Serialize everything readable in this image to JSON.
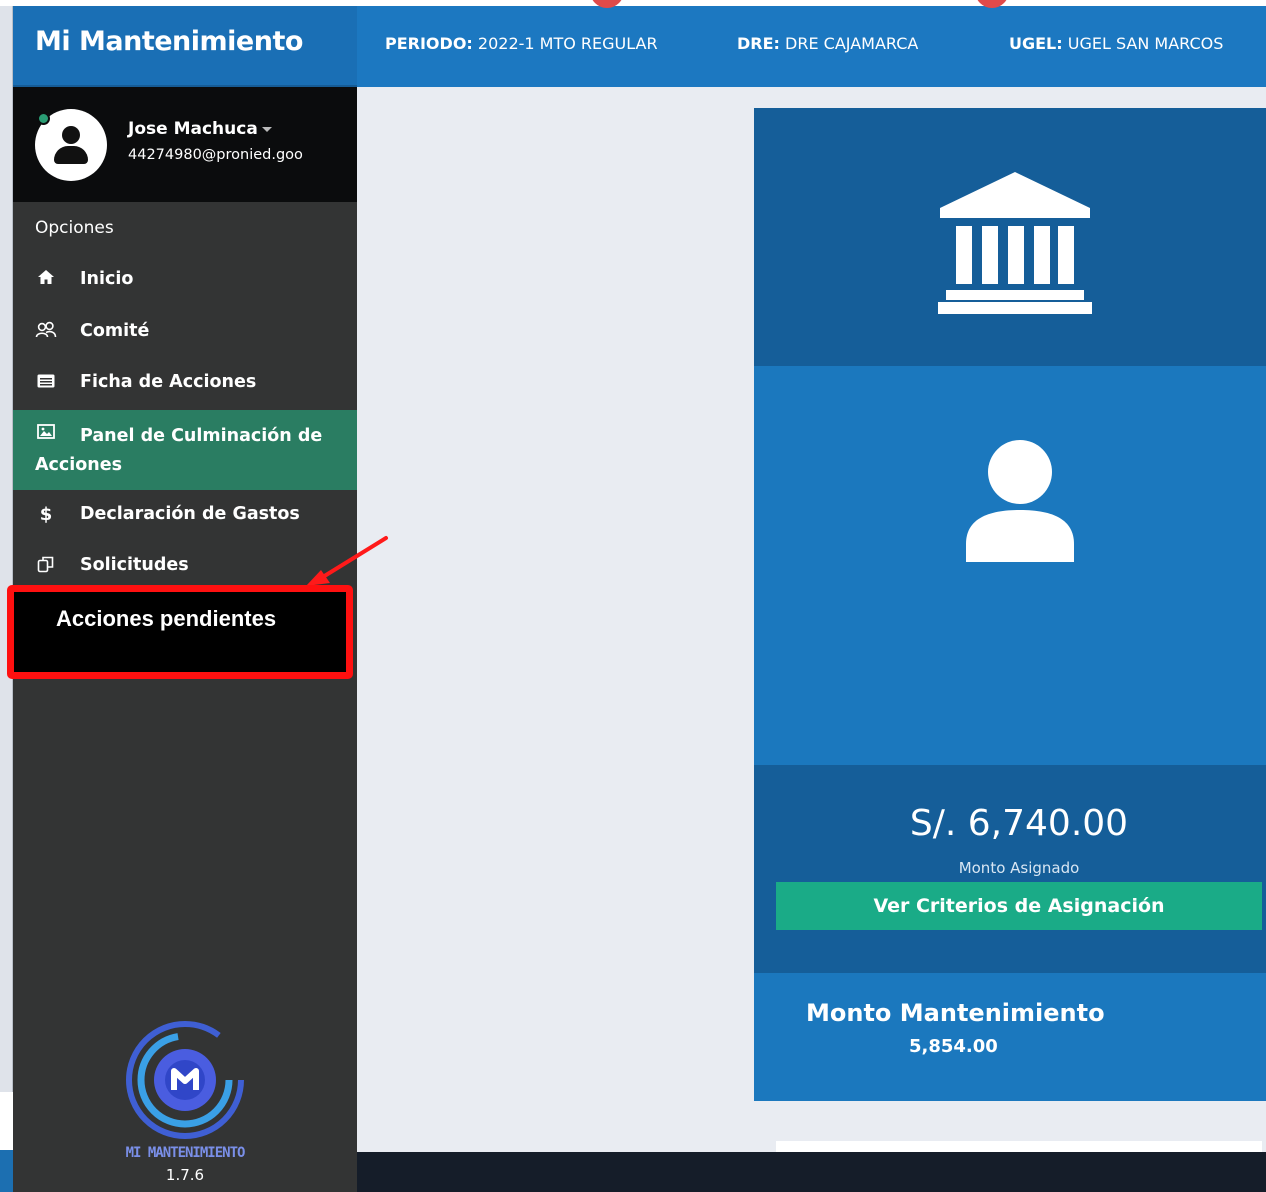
{
  "header": {
    "brand": "Mi Mantenimiento",
    "info": [
      {
        "label": "PERIODO:",
        "value": " 2022-1 MTO REGULAR"
      },
      {
        "label": "DRE:",
        "value": " DRE CAJAMARCA"
      },
      {
        "label": "UGEL:",
        "value": " UGEL SAN MARCOS"
      }
    ]
  },
  "user": {
    "name": "Jose Machuca",
    "email": "44274980@pronied.goo"
  },
  "sidebar": {
    "section_label": "Opciones",
    "items": [
      {
        "label": "Inicio",
        "icon": "home-icon"
      },
      {
        "label": "Comité",
        "icon": "users-icon"
      },
      {
        "label": "Ficha de Acciones",
        "icon": "list-icon"
      },
      {
        "label": "Panel de Culminación de Acciones",
        "icon": "image-icon"
      },
      {
        "label": "Declaración de Gastos",
        "icon": "dollar-icon"
      },
      {
        "label": "Solicitudes",
        "icon": "copy-icon"
      }
    ],
    "annotation": "Acciones pendientes",
    "app_name": "MI MANTENIMIENTO",
    "app_version": "1.7.6"
  },
  "main": {
    "amount": "S/. 6,740.00",
    "amount_caption": "Monto Asignado",
    "criteria_button": "Ver Criterios de Asignación",
    "maintenance_title": "Monto Mantenimiento",
    "maintenance_value": "5,854.00"
  },
  "colors": {
    "brand_blue": "#1a6fb5",
    "active_green": "#2a7d62",
    "button_green": "#1aab87",
    "highlight_red": "#ff1010"
  }
}
